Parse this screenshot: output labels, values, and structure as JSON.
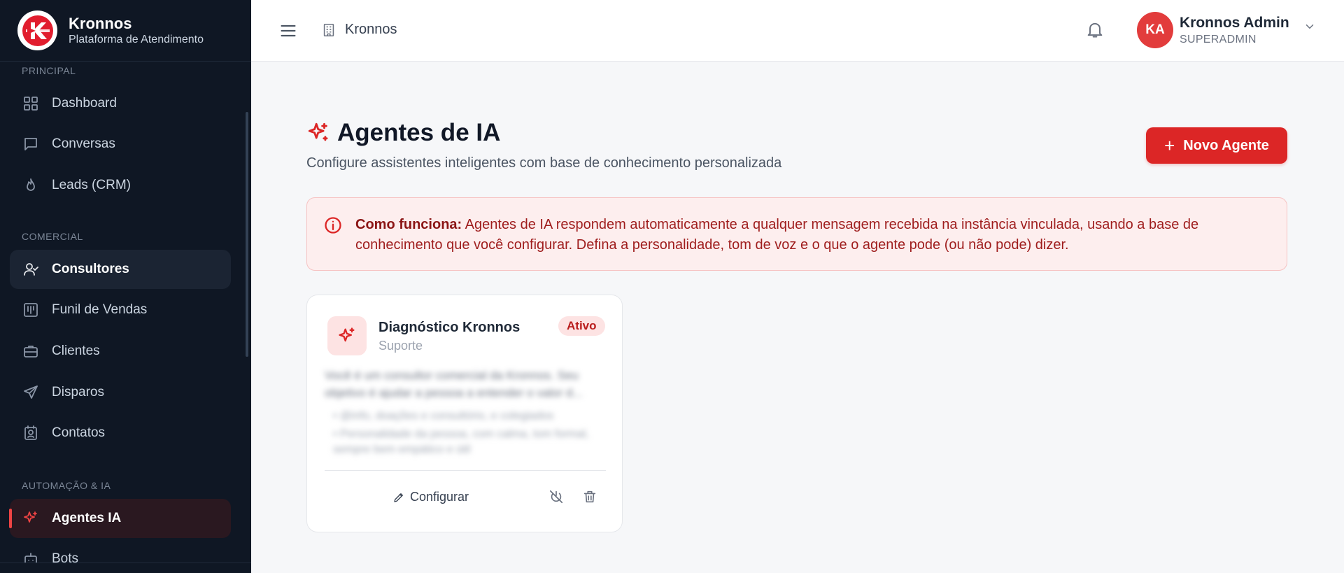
{
  "brand": {
    "title": "Kronnos",
    "subtitle": "Plataforma de Atendimento"
  },
  "sidebar": {
    "sections": [
      {
        "label": "PRINCIPAL"
      },
      {
        "label": "COMERCIAL"
      },
      {
        "label": "AUTOMAÇÃO & IA"
      }
    ],
    "items": [
      {
        "label": "Dashboard",
        "icon": "grid-icon"
      },
      {
        "label": "Conversas",
        "icon": "chat-icon"
      },
      {
        "label": "Leads (CRM)",
        "icon": "flame-icon"
      },
      {
        "label": "Consultores",
        "icon": "user-check-icon",
        "active": true
      },
      {
        "label": "Funil de Vendas",
        "icon": "kanban-icon"
      },
      {
        "label": "Clientes",
        "icon": "briefcase-icon"
      },
      {
        "label": "Disparos",
        "icon": "send-icon"
      },
      {
        "label": "Contatos",
        "icon": "contact-icon"
      },
      {
        "label": "Agentes IA",
        "icon": "sparkles-icon",
        "selected": true
      },
      {
        "label": "Bots",
        "icon": "bot-icon"
      }
    ]
  },
  "header": {
    "breadcrumb": "Kronnos",
    "user": {
      "initials": "KA",
      "name": "Kronnos Admin",
      "role": "SUPERADMIN"
    }
  },
  "page": {
    "title": "Agentes de IA",
    "subtitle": "Configure assistentes inteligentes com base de conhecimento personalizada",
    "new_button": "Novo Agente"
  },
  "info": {
    "title": "Como funciona:",
    "text": " Agentes de IA respondem automaticamente a qualquer mensagem recebida na instância vinculada, usando a base de conhecimento que você configurar. Defina a personalidade, tom de voz e o que o agente pode (ou não pode) dizer."
  },
  "agents": [
    {
      "name": "Diagnóstico Kronnos",
      "type": "Suporte",
      "status": "Ativo",
      "preview": "Você é um consultor comercial da Kronnos. Seu objetivo é ajudar a pessoa a entender o valor d...",
      "bullets": [
        "• @info, doações e consultório, e colegiados",
        "• Personalidade da pessoa, com calma, tom formal, sempre bem empático e útil"
      ],
      "configure_label": "Configurar"
    }
  ],
  "colors": {
    "brand_red": "#dc2626",
    "sidebar_bg": "#0f1724",
    "info_bg": "#fdeeee"
  }
}
